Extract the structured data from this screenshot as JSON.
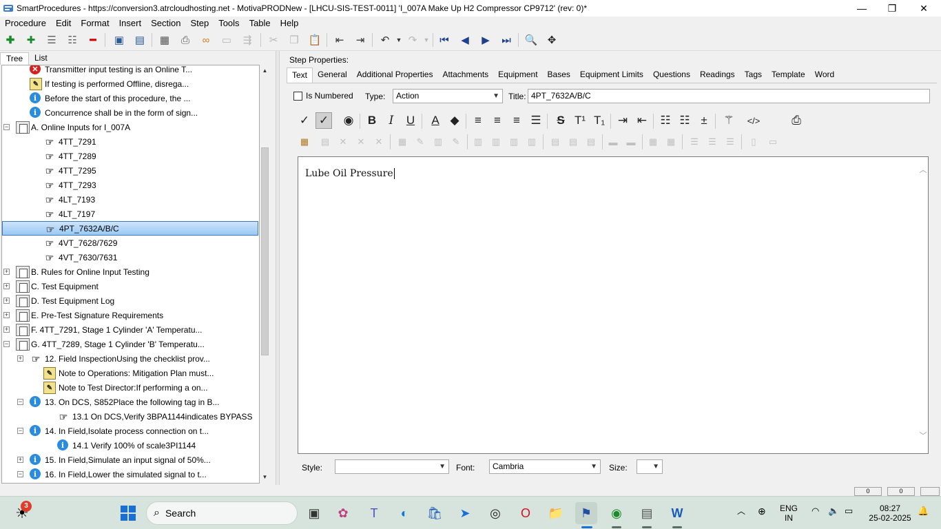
{
  "window": {
    "title": "SmartProcedures - https://conversion3.atrcloudhosting.net - MotivaPRODNew - [LHCU-SIS-TEST-0011] 'I_007A Make Up H2 Compressor CP9712' (rev: 0)*",
    "minimize": "—",
    "maximize": "❐",
    "close": "✕"
  },
  "menu": [
    "Procedure",
    "Edit",
    "Format",
    "Insert",
    "Section",
    "Step",
    "Tools",
    "Table",
    "Help"
  ],
  "left_tabs": [
    "Tree",
    "List"
  ],
  "tree": [
    {
      "icon": "x",
      "label": "Transmitter input testing is an Online T..."
    },
    {
      "icon": "note",
      "label": "If testing is performed Offline, disrega..."
    },
    {
      "icon": "info",
      "label": "Before the start of this procedure, the ..."
    },
    {
      "icon": "info",
      "label": "Concurrence shall be in the form of sign..."
    },
    {
      "icon": "section",
      "expander": "−",
      "label": "A. Online Inputs for I_007A"
    },
    {
      "icon": "hand",
      "label": "4TT_7291"
    },
    {
      "icon": "hand",
      "label": "4TT_7289"
    },
    {
      "icon": "hand",
      "label": "4TT_7295"
    },
    {
      "icon": "hand",
      "label": "4TT_7293"
    },
    {
      "icon": "hand",
      "label": "4LT_7193"
    },
    {
      "icon": "hand",
      "label": "4LT_7197"
    },
    {
      "icon": "hand",
      "label": "4PT_7632A/B/C",
      "selected": true
    },
    {
      "icon": "hand",
      "label": "4VT_7628/7629"
    },
    {
      "icon": "hand",
      "label": "4VT_7630/7631"
    },
    {
      "icon": "section",
      "expander": "+",
      "label": "B. Rules for Online Input Testing"
    },
    {
      "icon": "section",
      "expander": "+",
      "label": "C. Test Equipment"
    },
    {
      "icon": "section",
      "expander": "+",
      "label": "D. Test Equipment Log"
    },
    {
      "icon": "section",
      "expander": "+",
      "label": "E. Pre-Test Signature Requirements"
    },
    {
      "icon": "section",
      "expander": "+",
      "label": "F. 4TT_7291, Stage 1 Cylinder 'A' Temperatu..."
    },
    {
      "icon": "section",
      "expander": "−",
      "label": "G. 4TT_7289, Stage 1 Cylinder 'B' Temperatu..."
    },
    {
      "icon": "hand",
      "expander": "+",
      "label": "12. Field InspectionUsing the checklist prov..."
    },
    {
      "icon": "note",
      "label": "Note to Operations: Mitigation Plan must..."
    },
    {
      "icon": "note",
      "label": "Note to Test Director:If performing a on..."
    },
    {
      "icon": "info",
      "expander": "−",
      "label": "13. On DCS, S852Place the following tag in B..."
    },
    {
      "icon": "hand",
      "label": "13.1 On DCS,Verify 3BPA1144indicates BYPASS"
    },
    {
      "icon": "info",
      "expander": "−",
      "label": "14. In Field,Isolate process connection on t..."
    },
    {
      "icon": "info",
      "label": "14.1 Verify 100% of scale3PI1144"
    },
    {
      "icon": "info",
      "expander": "+",
      "label": "15. In Field,Simulate an input signal of 50%..."
    },
    {
      "icon": "info",
      "expander": "−",
      "label": "16. In Field,Lower the simulated signal to t..."
    }
  ],
  "right": {
    "heading": "Step Properties:",
    "tabs": [
      "Text",
      "General",
      "Additional Properties",
      "Attachments",
      "Equipment",
      "Bases",
      "Equipment Limits",
      "Questions",
      "Readings",
      "Tags",
      "Template",
      "Word"
    ],
    "is_numbered_label": "Is Numbered",
    "type_label": "Type:",
    "type_value": "Action",
    "title_label": "Title:",
    "title_value": "4PT_7632A/B/C",
    "editor_text": "Lube Oil Pressure",
    "style_label": "Style:",
    "style_value": "",
    "font_label": "Font:",
    "font_value": "Cambria",
    "size_label": "Size:",
    "size_value": ""
  },
  "status": {
    "box1": "0",
    "box2": "0"
  },
  "taskbar": {
    "search_placeholder": "Search",
    "weather_badge": "3",
    "lang_line1": "ENG",
    "lang_line2": "IN",
    "time": "08:27",
    "date": "25-02-2025"
  }
}
